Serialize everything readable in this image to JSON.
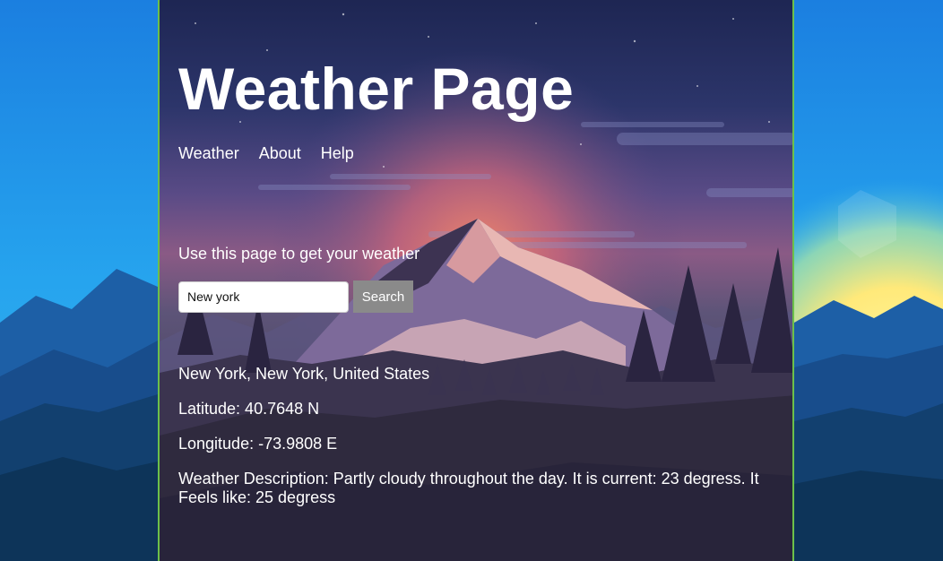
{
  "header": {
    "title": "Weather Page"
  },
  "nav": {
    "items": [
      "Weather",
      "About",
      "Help"
    ]
  },
  "main": {
    "intro": "Use this page to get your weather",
    "search": {
      "value": "New york",
      "button_label": "Search"
    },
    "results": {
      "location": "New York, New York, United States",
      "latitude": "Latitude: 40.7648 N",
      "longitude": "Longitude: -73.9808 E",
      "description": "Weather Description: Partly cloudy throughout the day. It is current: 23 degress. It Feels like: 25 degress"
    }
  },
  "colors": {
    "card_border": "#6cc04a",
    "search_button": "#8a8a8a",
    "sky_top": "#1e2650",
    "sunset_glow": "#e07a5f",
    "background_blue": "#1b6fc8"
  }
}
